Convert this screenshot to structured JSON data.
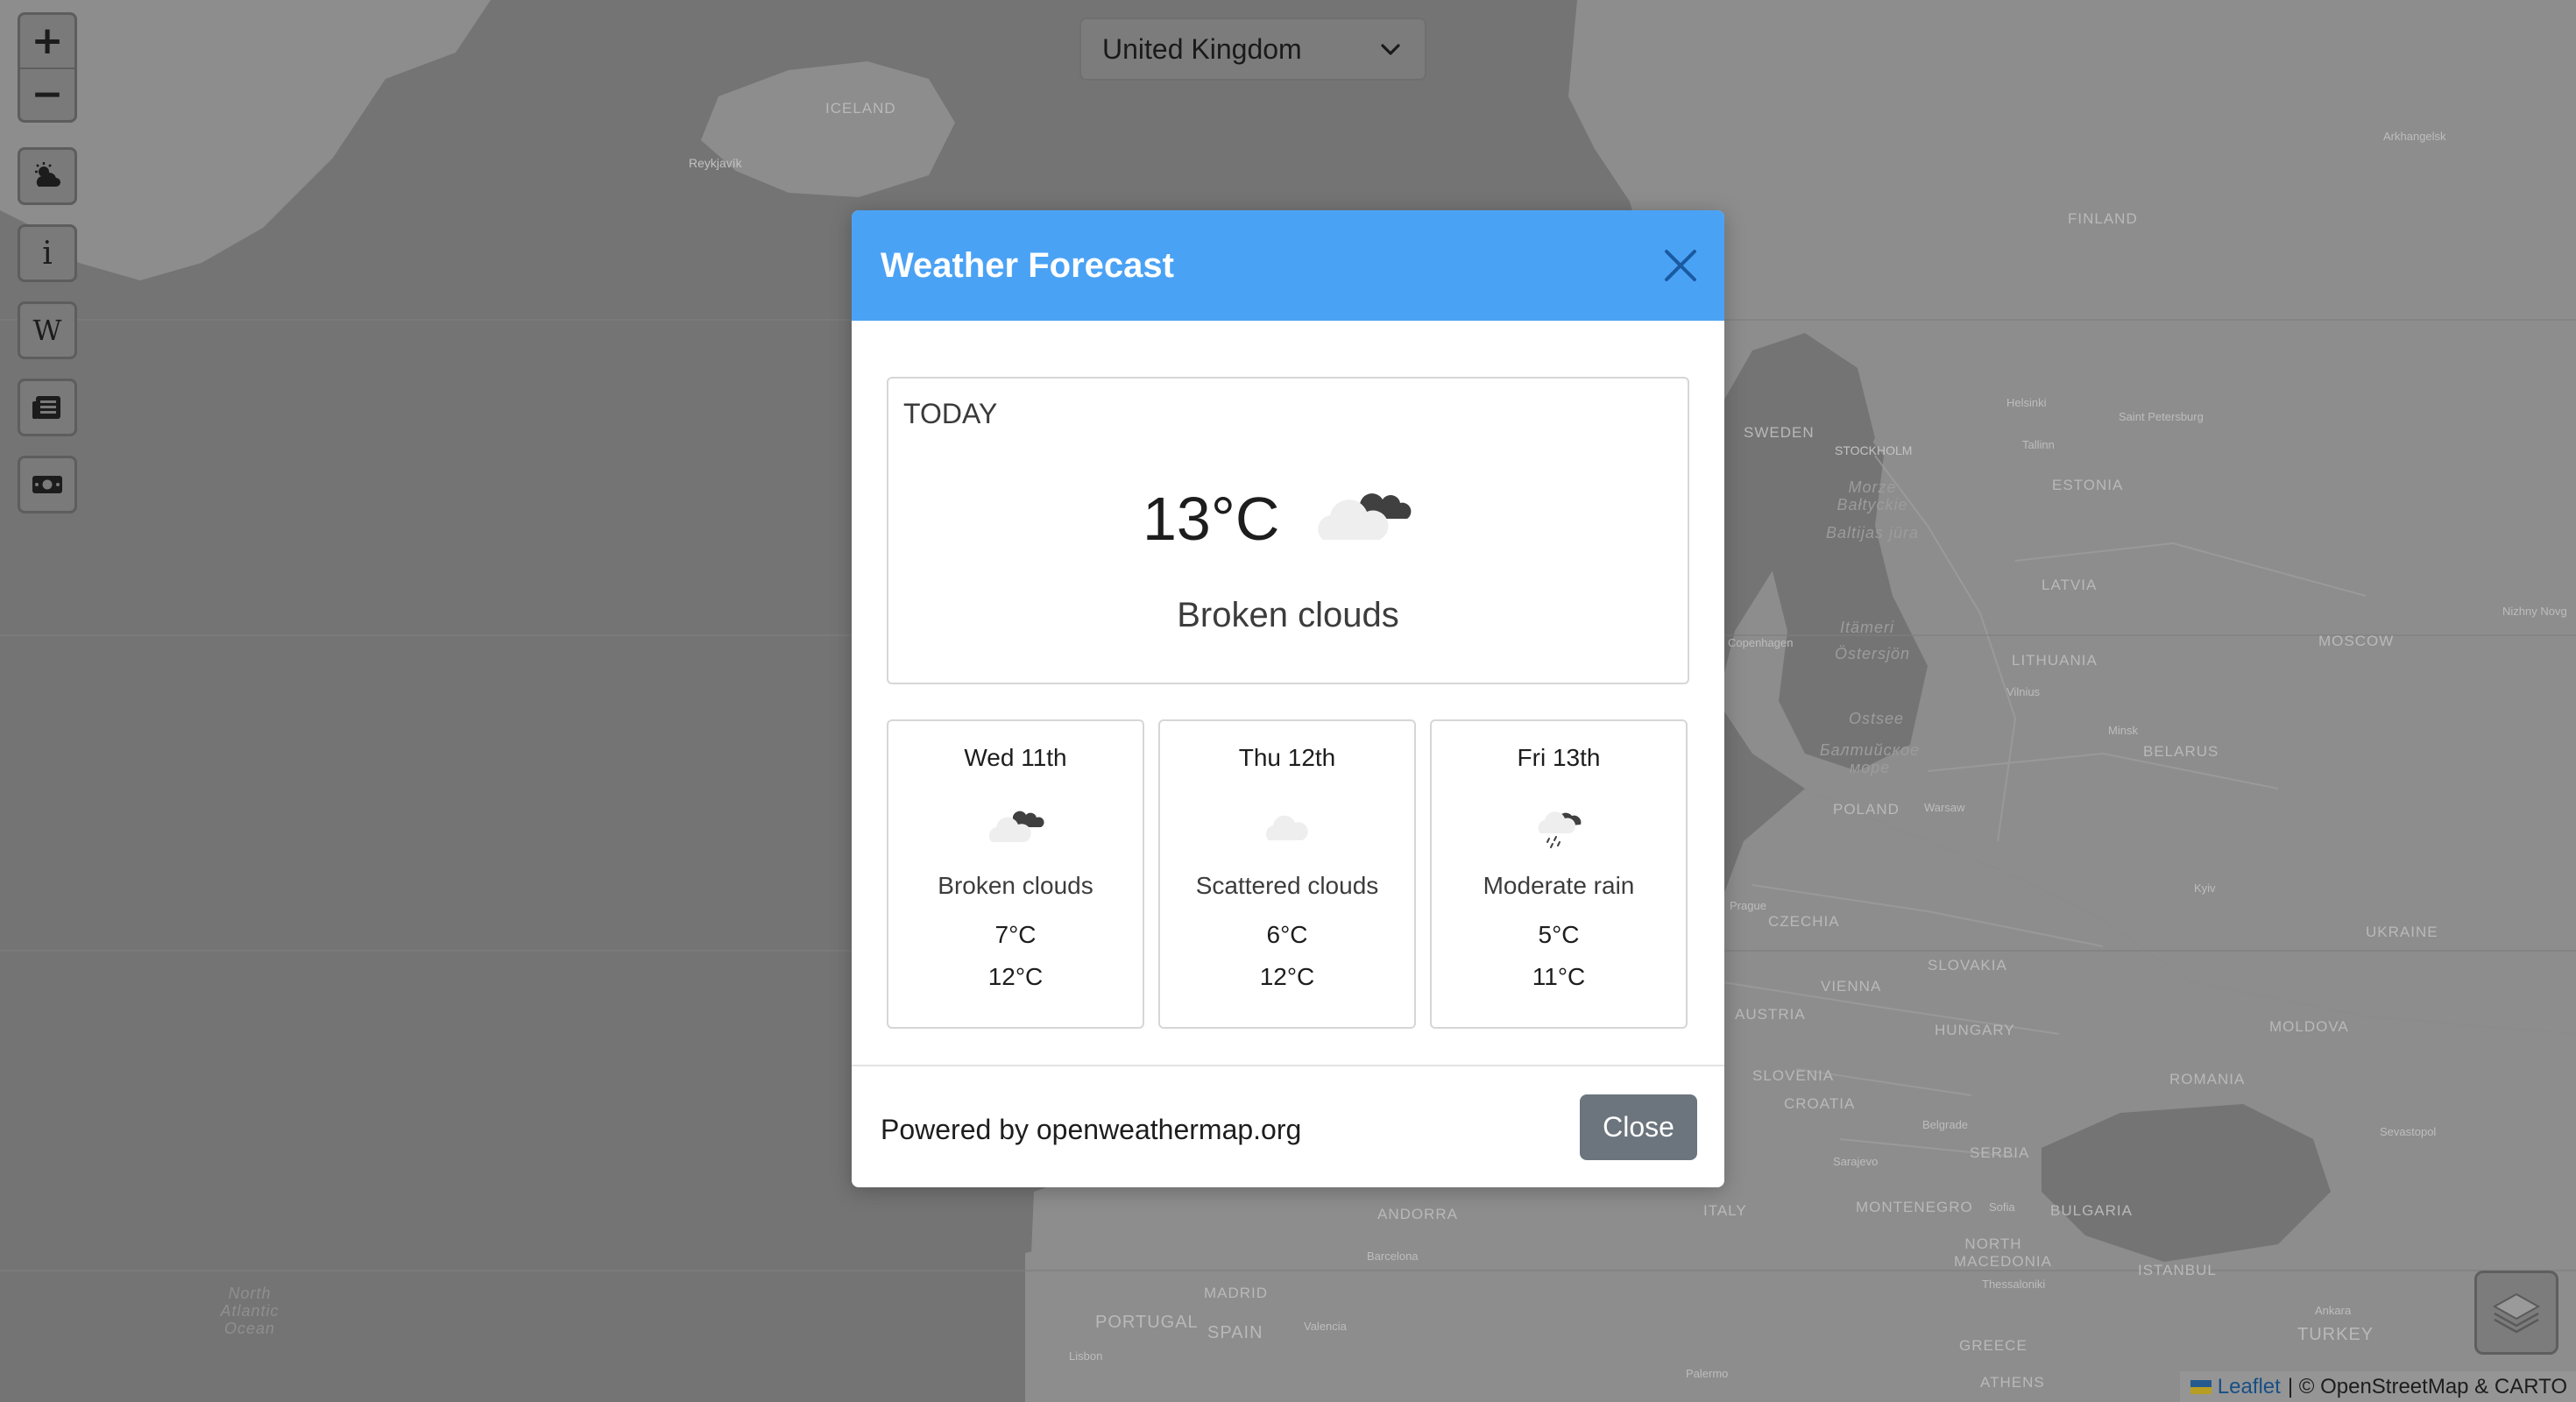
{
  "map": {
    "labels": {
      "iceland": "ICELAND",
      "reykjavik": "Reykjavík",
      "finland": "FINLAND",
      "sweden": "SWEDEN",
      "stockholm": "STOCKHOLM",
      "helsinki": "Helsinki",
      "tallinn": "Tallinn",
      "st_petersburg": "Saint Petersburg",
      "estonia": "ESTONIA",
      "latvia": "LATVIA",
      "lithuania": "LITHUANIA",
      "vilnius": "Vilnius",
      "moscow": "MOSCOW",
      "nizhny": "Nizhny Novg",
      "arkhangelsk": "Arkhangelsk",
      "minsk": "Minsk",
      "belarus": "BELARUS",
      "poland": "POLAND",
      "warsaw": "Warsaw",
      "prague": "Prague",
      "czechia": "CZECHIA",
      "kyiv": "Kyiv",
      "ukraine": "UKRAINE",
      "slovakia": "SLOVAKIA",
      "vienna": "VIENNA",
      "austria": "AUSTRIA",
      "hungary": "HUNGARY",
      "moldova": "MOLDOVA",
      "slovenia": "SLOVENIA",
      "croatia": "CROATIA",
      "romania": "ROMANIA",
      "belgrade": "Belgrade",
      "serbia": "SERBIA",
      "sevastopol": "Sevastopol",
      "sarajevo": "Sarajevo",
      "montenegro": "MONTENEGRO",
      "sofia": "Sofia",
      "bulgaria": "BULGARIA",
      "north_macedonia": "NORTH MACEDONIA",
      "thessaloniki": "Thessaloniki",
      "istanbul": "ISTANBUL",
      "ankara": "Ankara",
      "turkey": "TURKEY",
      "greece": "GREECE",
      "athens": "ATHENS",
      "italy": "ITALY",
      "andorra": "ANDORRA",
      "barcelona": "Barcelona",
      "madrid": "MADRID",
      "portugal": "PORTUGAL",
      "spain": "SPAIN",
      "valencia": "Valencia",
      "lisbon": "Lisbon",
      "palermo": "Palermo",
      "copenhagen": "Copenhagen",
      "baltic_sea_1": "Morze Bałtyckie",
      "baltic_sea_2": "Baltijas jūra",
      "baltic_sea_3": "Itämeri",
      "baltic_sea_4": "Östersjön",
      "baltic_sea_5": "Ostsee",
      "baltic_sea_6": "Балтийское море",
      "north_atlantic": "North Atlantic Ocean"
    }
  },
  "controls": {
    "zoom_in": "+",
    "zoom_out": "−",
    "info_label": "i",
    "wiki_label": "W"
  },
  "country_select": {
    "value": "United Kingdom"
  },
  "modal": {
    "title": "Weather Forecast",
    "today": {
      "label": "TODAY",
      "temp": "13°C",
      "icon": "broken-clouds-icon",
      "description": "Broken clouds"
    },
    "days": [
      {
        "name": "Wed 11th",
        "icon": "broken-clouds-icon",
        "description": "Broken clouds",
        "min": "7°C",
        "max": "12°C"
      },
      {
        "name": "Thu 12th",
        "icon": "scattered-clouds-icon",
        "description": "Scattered clouds",
        "min": "6°C",
        "max": "12°C"
      },
      {
        "name": "Fri 13th",
        "icon": "moderate-rain-icon",
        "description": "Moderate rain",
        "min": "5°C",
        "max": "11°C"
      }
    ],
    "footer": {
      "powered_by": "Powered by openweathermap.org",
      "close_label": "Close"
    }
  },
  "attribution": {
    "leaflet": "Leaflet",
    "rest": "| © OpenStreetMap & CARTO"
  },
  "colors": {
    "header_blue": "#4aa2f5",
    "close_button": "#6c757d",
    "map_land": "#8c8c8c",
    "map_sea": "#747474"
  }
}
